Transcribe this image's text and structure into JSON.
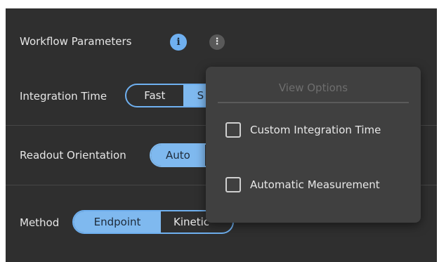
{
  "header": {
    "title": "Workflow Parameters",
    "info_icon": "i",
    "more_icon": "⋮"
  },
  "rows": {
    "integration_time": {
      "label": "Integration Time",
      "options": [
        "Fast",
        "S"
      ],
      "selected": "S"
    },
    "readout_orientation": {
      "label": "Readout Orientation",
      "options": [
        "Auto",
        ""
      ],
      "selected": "Auto"
    },
    "method": {
      "label": "Method",
      "options": [
        "Endpoint",
        "Kinetic"
      ],
      "selected": "Endpoint"
    }
  },
  "view_options_menu": {
    "title": "View Options",
    "items": [
      {
        "label": "Custom Integration Time",
        "checked": false
      },
      {
        "label": "Automatic Measurement",
        "checked": false
      }
    ]
  },
  "colors": {
    "panel_bg": "#2f2f2f",
    "accent": "#6fb0f0",
    "menu_bg": "#404040"
  }
}
